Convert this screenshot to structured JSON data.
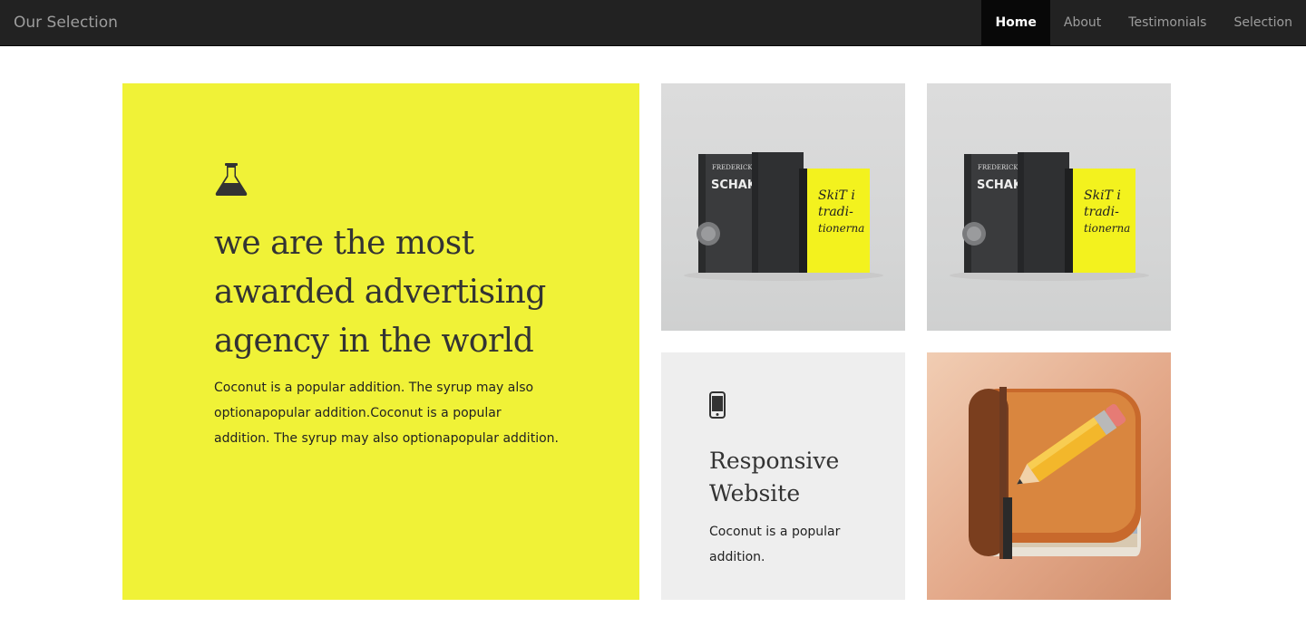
{
  "navbar": {
    "brand": "Our Selection",
    "items": [
      {
        "label": "Home",
        "active": true
      },
      {
        "label": "About",
        "active": false
      },
      {
        "label": "Testimonials",
        "active": false
      },
      {
        "label": "Selection",
        "active": false
      }
    ]
  },
  "hero": {
    "icon": "flask-icon",
    "heading_lines": [
      "we are the most",
      "awarded advertising",
      "agency in the world"
    ],
    "text": "Coconut is a popular addition. The syrup may also optionapopular addition.Coconut is a popular addition. The syrup may also optionapopular addition.",
    "background": "#f0f237"
  },
  "gallery": {
    "books_cover_text": {
      "author": "FREDERICK FORSYTH",
      "title": "SCHAK",
      "spine": "SCHAKALEN",
      "yellow_title": "SkiT i tradi-tionerna"
    }
  },
  "feature": {
    "icon": "mobile-phone-icon",
    "title": "Responsive Website",
    "text": "Coconut is a popular addition.",
    "background": "#eeeeee"
  },
  "colors": {
    "navbar_bg": "#222222",
    "nav_active_bg": "#080808",
    "accent_yellow": "#f0f237"
  }
}
